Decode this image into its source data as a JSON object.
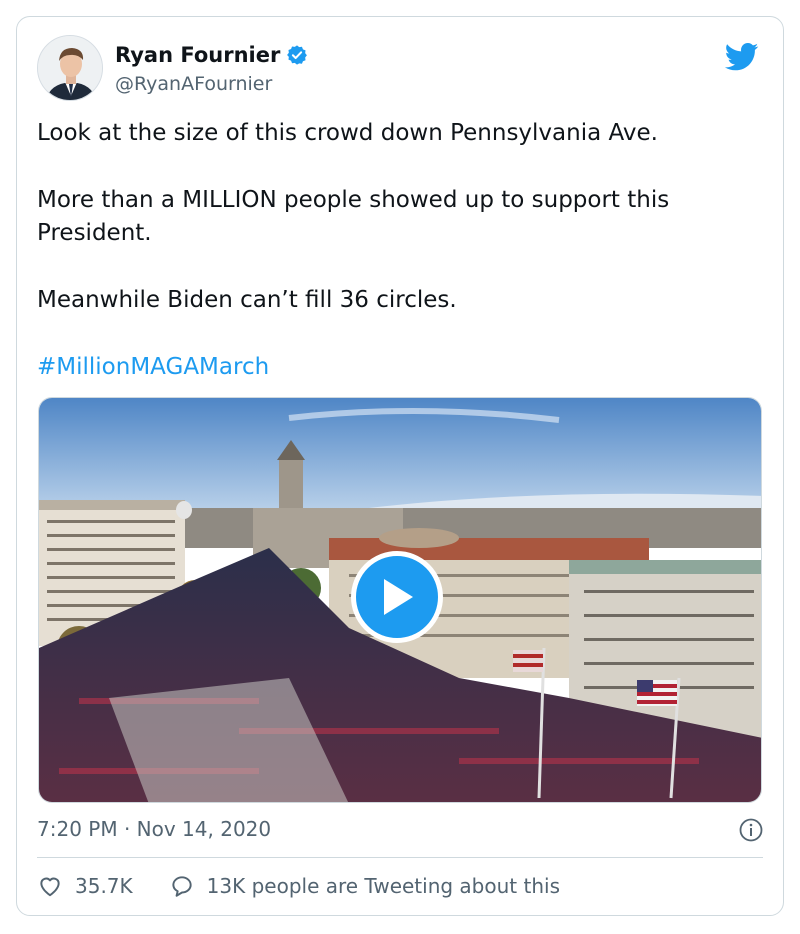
{
  "author": {
    "display_name": "Ryan Fournier",
    "handle": "@RyanAFournier"
  },
  "icons": {
    "verified": "verified-badge-icon",
    "platform": "twitter-bird-icon",
    "play": "play-icon",
    "info": "info-icon",
    "like": "heart-icon",
    "reply": "speech-bubble-icon"
  },
  "tweet": {
    "line1": "Look at the size of this crowd down Pennsylvania Ave.",
    "line2": "More than a MILLION people showed up to support this President.",
    "line3": "Meanwhile Biden can’t fill 36 circles.",
    "hashtag": "#MillionMAGAMarch"
  },
  "meta": {
    "timestamp": "7:20 PM · Nov 14, 2020"
  },
  "actions": {
    "likes": "35.7K",
    "conversation": "13K people are Tweeting about this"
  },
  "colors": {
    "accent": "#1d9bf0",
    "text": "#0f1419",
    "muted": "#536471",
    "border": "#cfd9de"
  }
}
